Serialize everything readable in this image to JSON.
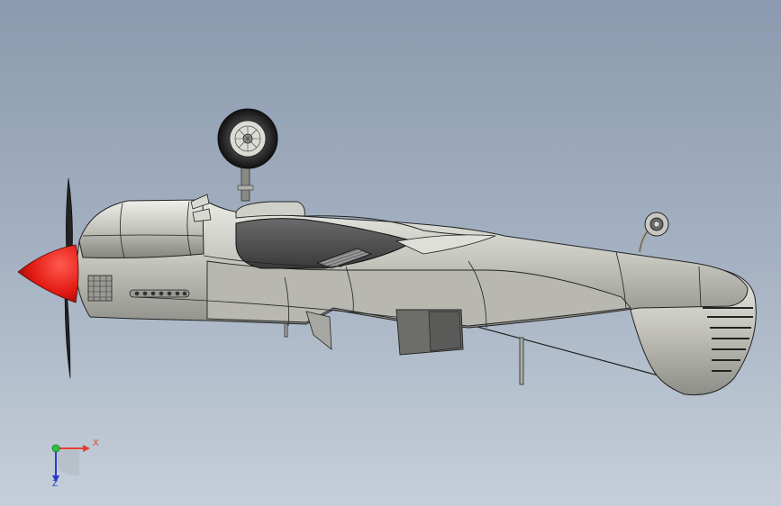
{
  "viewport": {
    "background_top": "#8b9aae",
    "background_bottom": "#c6cfd9"
  },
  "model": {
    "description_icon": "aircraft-side-view-icon",
    "body_color": "#c9c9c2",
    "spinner_color": "#e21a12",
    "edge_color": "#2a2a2a"
  },
  "triad": {
    "x_label": "X",
    "z_label": "Z",
    "x_color": "#e04030",
    "y_color": "#30c040",
    "z_color": "#2a3bd0"
  }
}
